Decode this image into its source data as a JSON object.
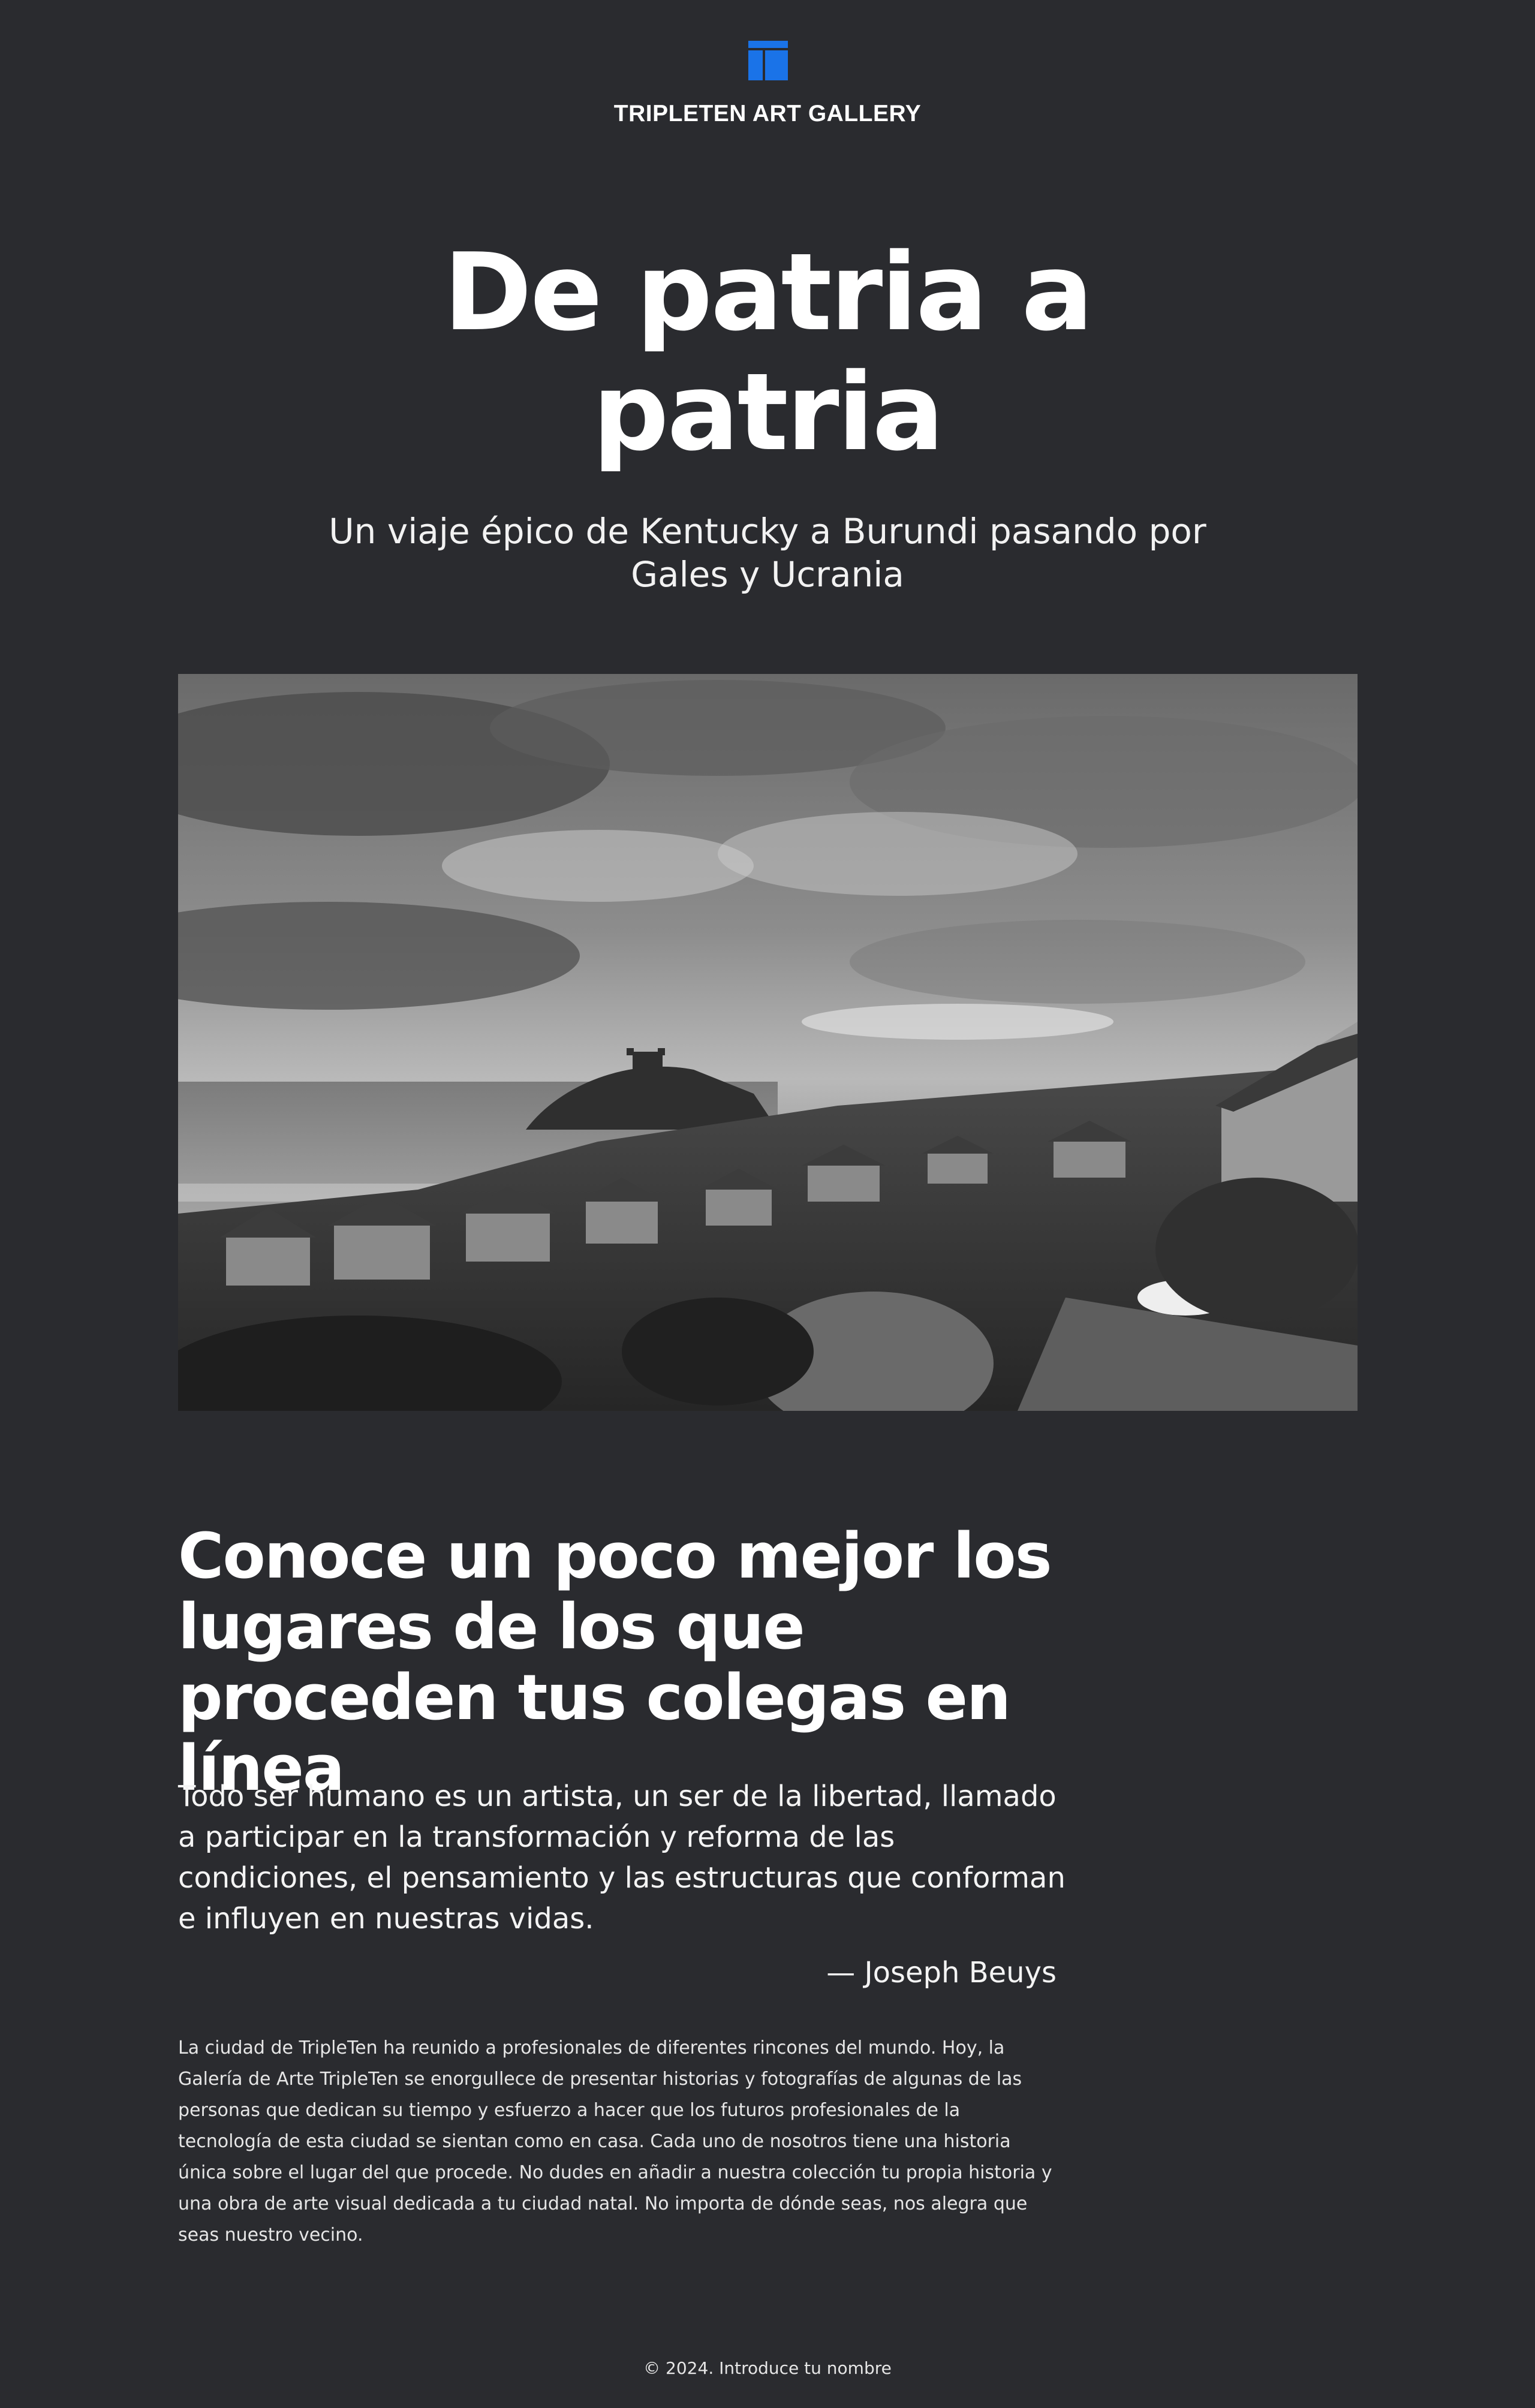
{
  "header": {
    "logo_icon": "gallery-logo-icon",
    "brand": "TRIPLETEN ART GALLERY",
    "accent_color": "#1a73e8"
  },
  "hero": {
    "title": "De patria a patria",
    "subtitle": "Un viaje épico de Kentucky a Burundi pasando por Gales y Ucrania"
  },
  "section": {
    "title": "Conoce un poco mejor los lugares de los que proceden tus colegas en línea",
    "quote": "Todo ser humano es un artista, un ser de la libertad, llamado a participar en la transformación y reforma de las condiciones, el pensamiento y las estructuras que conforman e influyen en nuestras vidas.",
    "quote_author": "— Joseph Beuys",
    "body": "La ciudad de TripleTen ha reunido a profesionales de diferentes rincones del mundo. Hoy, la Galería de Arte TripleTen se enorgullece de presentar historias y fotografías de algunas de las personas que dedican su tiempo y esfuerzo a hacer que los futuros profesionales de la tecnología de esta ciudad se sientan como en casa. Cada uno de nosotros tiene una historia única sobre el lugar del que procede. No dudes en añadir a nuestra colección tu propia historia y una obra de arte visual dedicada a tu ciudad natal. No importa de dónde seas, nos alegra que seas nuestro vecino."
  },
  "footer": {
    "text": "© 2024. Introduce tu nombre"
  },
  "colors": {
    "background": "#2a2b2f",
    "text": "#ffffff"
  }
}
